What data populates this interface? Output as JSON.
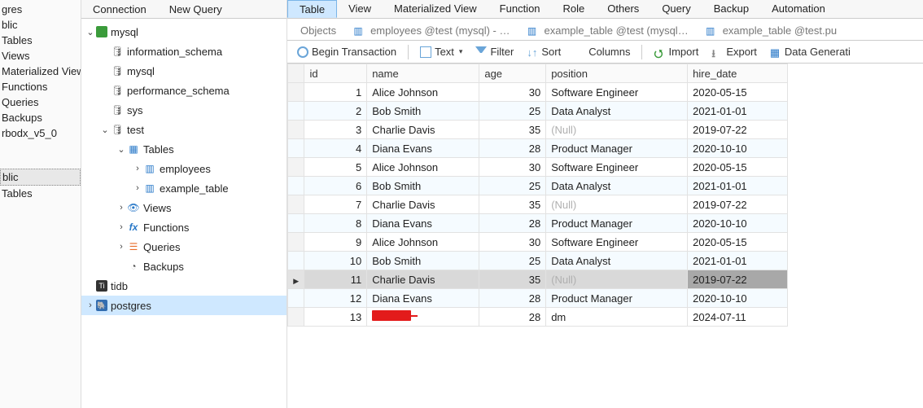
{
  "leftbar": {
    "items": [
      "gres",
      "blic",
      "Tables",
      "Views",
      "Materialized View",
      "Functions",
      "Queries",
      "Backups",
      "rbodx_v5_0"
    ],
    "sel_items": [
      "blic",
      "Tables"
    ]
  },
  "tree_menu": {
    "connection": "Connection",
    "newquery": "New Query"
  },
  "tree": {
    "mysql": "mysql",
    "information_schema": "information_schema",
    "mysql_db": "mysql",
    "performance_schema": "performance_schema",
    "sys": "sys",
    "test": "test",
    "tables_label": "Tables",
    "employees": "employees",
    "example_table": "example_table",
    "views": "Views",
    "functions": "Functions",
    "queries": "Queries",
    "backups": "Backups",
    "tidb": "tidb",
    "postgres": "postgres"
  },
  "main_menu": {
    "table": "Table",
    "view": "View",
    "matview": "Materialized View",
    "function": "Function",
    "role": "Role",
    "others": "Others",
    "query": "Query",
    "backup": "Backup",
    "automation": "Automation"
  },
  "tabs": {
    "objects": "Objects",
    "tab1": "employees @test (mysql) - …",
    "tab2": "example_table @test (mysql…",
    "tab3": "example_table @test.pu"
  },
  "toolbar": {
    "begin_tx": "Begin Transaction",
    "text": "Text",
    "filter": "Filter",
    "sort": "Sort",
    "columns": "Columns",
    "import": "Import",
    "export": "Export",
    "datagen": "Data Generati"
  },
  "columns": {
    "id": "id",
    "name": "name",
    "age": "age",
    "position": "position",
    "hire_date": "hire_date"
  },
  "chart_data": {
    "type": "table",
    "columns": [
      "id",
      "name",
      "age",
      "position",
      "hire_date"
    ],
    "rows": [
      {
        "id": 1,
        "name": "Alice Johnson",
        "age": 30,
        "position": "Software Engineer",
        "hire_date": "2020-05-15"
      },
      {
        "id": 2,
        "name": "Bob Smith",
        "age": 25,
        "position": "Data Analyst",
        "hire_date": "2021-01-01"
      },
      {
        "id": 3,
        "name": "Charlie Davis",
        "age": 35,
        "position": null,
        "hire_date": "2019-07-22"
      },
      {
        "id": 4,
        "name": "Diana Evans",
        "age": 28,
        "position": "Product Manager",
        "hire_date": "2020-10-10"
      },
      {
        "id": 5,
        "name": "Alice Johnson",
        "age": 30,
        "position": "Software Engineer",
        "hire_date": "2020-05-15"
      },
      {
        "id": 6,
        "name": "Bob Smith",
        "age": 25,
        "position": "Data Analyst",
        "hire_date": "2021-01-01"
      },
      {
        "id": 7,
        "name": "Charlie Davis",
        "age": 35,
        "position": null,
        "hire_date": "2019-07-22"
      },
      {
        "id": 8,
        "name": "Diana Evans",
        "age": 28,
        "position": "Product Manager",
        "hire_date": "2020-10-10"
      },
      {
        "id": 9,
        "name": "Alice Johnson",
        "age": 30,
        "position": "Software Engineer",
        "hire_date": "2020-05-15"
      },
      {
        "id": 10,
        "name": "Bob Smith",
        "age": 25,
        "position": "Data Analyst",
        "hire_date": "2021-01-01"
      },
      {
        "id": 11,
        "name": "Charlie Davis",
        "age": 35,
        "position": null,
        "hire_date": "2019-07-22",
        "_selected": true
      },
      {
        "id": 12,
        "name": "Diana Evans",
        "age": 28,
        "position": "Product Manager",
        "hire_date": "2020-10-10"
      },
      {
        "id": 13,
        "name": "[redacted]",
        "age": 28,
        "position": "dm",
        "hire_date": "2024-07-11",
        "_redacted_name": true
      }
    ]
  },
  "null_text": "(Null)"
}
